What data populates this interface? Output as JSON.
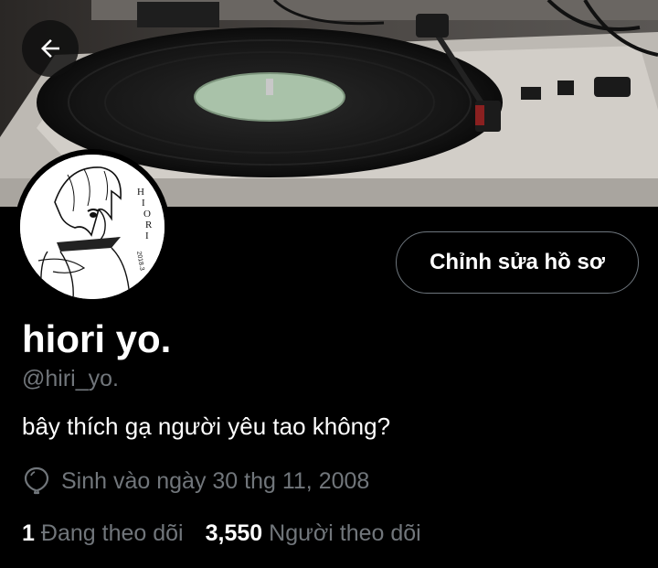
{
  "header": {
    "back_icon": "arrow-left-icon",
    "banner_description": "photo of a turntable with a vinyl record"
  },
  "profile": {
    "avatar_icon": "anime-sketch-avatar",
    "avatar_signature": "HIORI",
    "edit_button_label": "Chỉnh sửa hồ sơ",
    "display_name": "hiori yo.",
    "handle": "@hiri_yo.",
    "bio": "bây thích gạ người yêu tao không?",
    "birthday_icon": "balloon-icon",
    "birthday_text": "Sinh vào ngày 30 thg 11, 2008",
    "following_count": "1",
    "following_label": "Đang theo dõi",
    "followers_count": "3,550",
    "followers_label": "Người theo dõi"
  },
  "colors": {
    "background": "#000000",
    "primary_text": "#ffffff",
    "secondary_text": "#71767b",
    "button_border": "#6e767d"
  }
}
